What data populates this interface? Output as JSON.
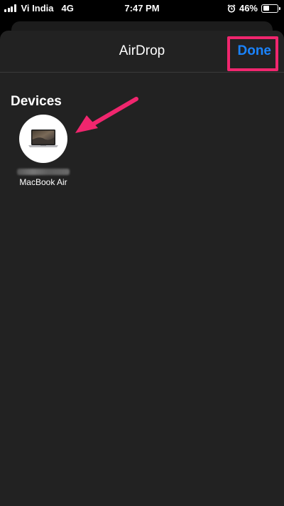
{
  "status_bar": {
    "carrier": "Vi India",
    "network": "4G",
    "time": "7:47 PM",
    "battery_text": "46%",
    "battery_level": 0.46,
    "icons": [
      "signal-icon",
      "alarm-icon",
      "battery-icon"
    ]
  },
  "sheet": {
    "title": "AirDrop",
    "done_label": "Done"
  },
  "devices": {
    "section_title": "Devices",
    "items": [
      {
        "label": "MacBook Air",
        "icon": "macbook-icon"
      }
    ]
  },
  "annotations": {
    "highlight_color": "#f0266e",
    "arrow_color": "#f0266e"
  },
  "colors": {
    "accent": "#1a84ff",
    "sheet_background": "#222222"
  }
}
